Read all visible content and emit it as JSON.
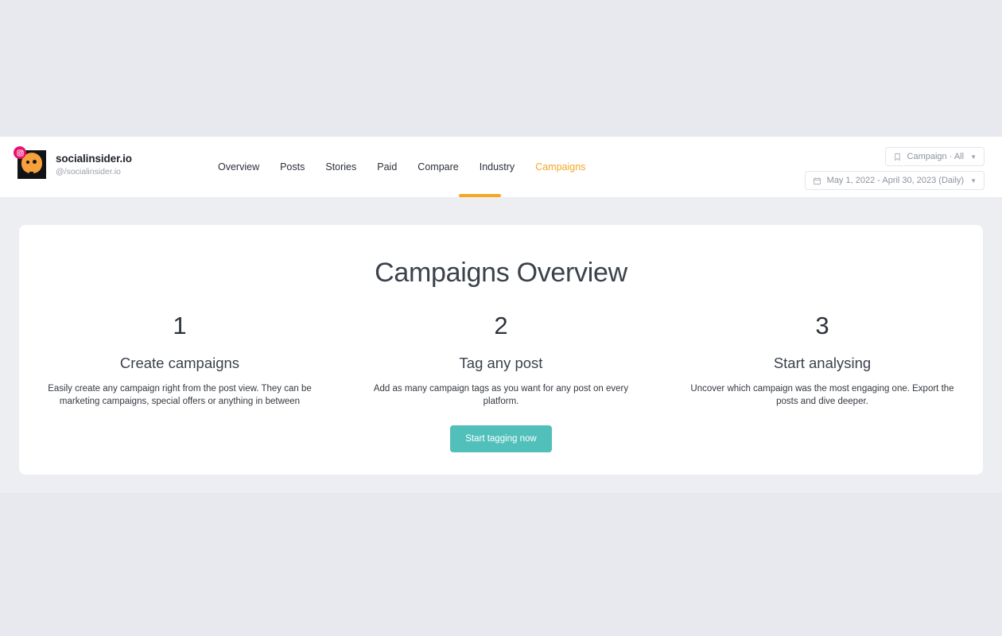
{
  "profile": {
    "name": "socialinsider.io",
    "handle": "@/socialinsider.io",
    "avatar_icon": "instagram-badge-icon"
  },
  "nav": {
    "items": [
      {
        "label": "Overview",
        "active": false
      },
      {
        "label": "Posts",
        "active": false
      },
      {
        "label": "Stories",
        "active": false
      },
      {
        "label": "Paid",
        "active": false
      },
      {
        "label": "Compare",
        "active": false
      },
      {
        "label": "Industry",
        "active": false
      },
      {
        "label": "Campaigns",
        "active": true
      }
    ],
    "active_color": "#f5a623"
  },
  "controls": {
    "campaign_filter": {
      "icon": "bookmark-icon",
      "label": "Campaign · All",
      "caret": "▼"
    },
    "date_range": {
      "icon": "calendar-icon",
      "label": "May 1, 2022 - April 30, 2023 (Daily)",
      "caret": "▼"
    }
  },
  "main": {
    "title": "Campaigns Overview",
    "steps": [
      {
        "number": "1",
        "heading": "Create campaigns",
        "description": "Easily create any campaign right from the post view. They can be marketing campaigns, special offers or anything in between"
      },
      {
        "number": "2",
        "heading": "Tag any post",
        "description": "Add as many campaign tags as you want for any post on every platform."
      },
      {
        "number": "3",
        "heading": "Start analysing",
        "description": "Uncover which campaign was the most engaging one. Export the posts and dive deeper."
      }
    ],
    "cta_label": "Start tagging now",
    "cta_color": "#51c0bb"
  }
}
